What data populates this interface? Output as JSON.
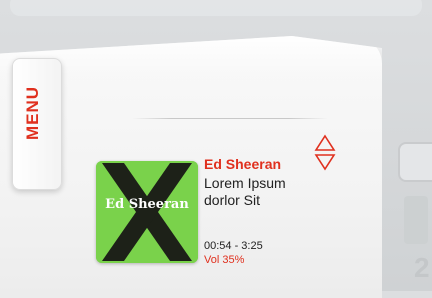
{
  "menu": {
    "label": "MENU"
  },
  "track": {
    "artist": "Ed Sheeran",
    "title": "Lorem Ipsum dorlor Sit",
    "time": "00:54 - 3:25",
    "volume": "Vol 35%"
  },
  "album": {
    "artist_text": "Ed Sheeran",
    "subtitle_text": "",
    "bg_color": "#7ad24b"
  },
  "background": {
    "digit": "2"
  },
  "icons": {
    "up": "triangle-up-outline-icon",
    "down": "triangle-down-outline-icon"
  },
  "colors": {
    "accent": "#e0301e",
    "text": "#222222",
    "panel": "#f5f5f5"
  }
}
